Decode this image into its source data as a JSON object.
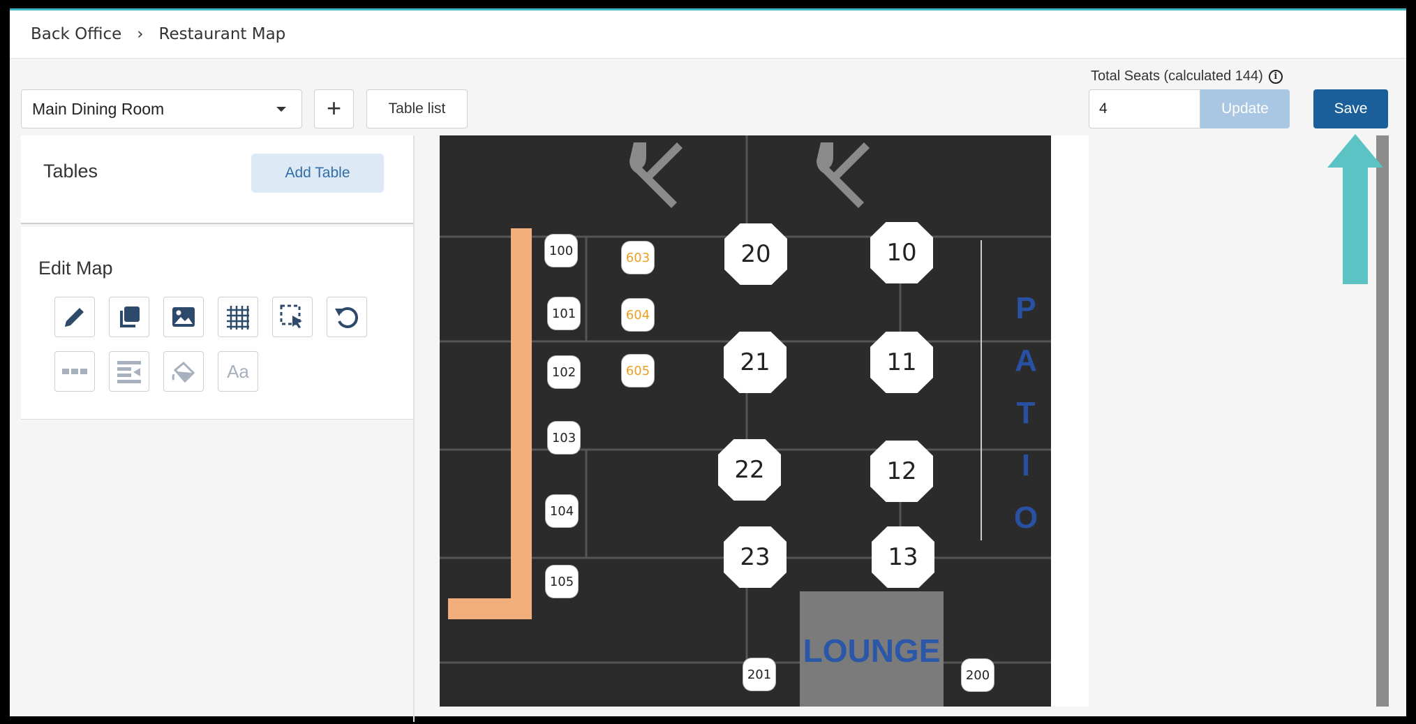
{
  "breadcrumb": {
    "home": "Back Office",
    "separator": "›",
    "current": "Restaurant Map"
  },
  "toolbar": {
    "room_selected": "Main Dining Room",
    "add_room_label": "+",
    "table_list_label": "Table list",
    "total_seats_label": "Total Seats (calculated 144)",
    "info_glyph": "i",
    "seats_value": "4",
    "update_label": "Update",
    "save_label": "Save"
  },
  "tables_panel": {
    "title": "Tables",
    "add_table_label": "Add Table"
  },
  "edit_map": {
    "title": "Edit Map",
    "tools_row1": [
      "pencil-icon",
      "copy-icon",
      "image-icon",
      "grid-icon",
      "select-icon",
      "undo-icon"
    ],
    "tools_row2": [
      "dashed-line-icon",
      "align-icon",
      "paint-bucket-icon",
      "text-icon"
    ],
    "text_tool_glyph": "Aa"
  },
  "map": {
    "large_tables": [
      "20",
      "10",
      "21",
      "11",
      "22",
      "12",
      "23",
      "13"
    ],
    "small_tables": [
      "100",
      "101",
      "102",
      "103",
      "104",
      "105",
      "201",
      "200"
    ],
    "orange_tables": [
      "603",
      "604",
      "605"
    ],
    "patio_letters": [
      "P",
      "A",
      "T",
      "I",
      "O"
    ],
    "lounge_label": "LOUNGE"
  },
  "colors": {
    "save": "#1b5f9a",
    "update_disabled": "#a9c6e2",
    "arrow": "#5bc3c3",
    "bar": "#f2ae7b",
    "patio": "#2951a3"
  }
}
